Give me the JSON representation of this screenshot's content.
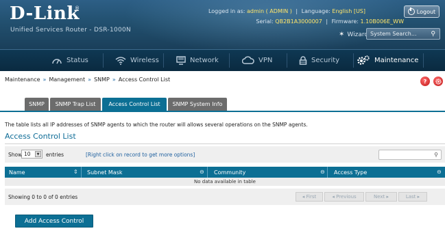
{
  "header": {
    "logo": "D-Link",
    "product": "Unified Services Router - DSR-1000N",
    "logged_in_label": "Logged in as:",
    "logged_in_value": "admin ( ADMIN )",
    "language_label": "Language:",
    "language_value": "English [US]",
    "serial_label": "Serial:",
    "serial_value": "QB2B1A3000007",
    "firmware_label": "Firmware:",
    "firmware_value": "1.10B006E_WW",
    "logout_label": "Logout",
    "wizard_label": "Wizard",
    "search_placeholder": "System Search..."
  },
  "nav": {
    "items": [
      {
        "label": "Status",
        "icon": "speedometer-icon"
      },
      {
        "label": "Wireless",
        "icon": "wifi-icon"
      },
      {
        "label": "Network",
        "icon": "monitor-icon"
      },
      {
        "label": "VPN",
        "icon": "cloud-icon"
      },
      {
        "label": "Security",
        "icon": "lock-icon"
      },
      {
        "label": "Maintenance",
        "icon": "gears-icon",
        "active": true
      }
    ]
  },
  "breadcrumb": {
    "items": [
      "Maintenance",
      "Management",
      "SNMP",
      "Access Control List"
    ],
    "separator": "»"
  },
  "tabs": [
    {
      "label": "SNMP"
    },
    {
      "label": "SNMP Trap List"
    },
    {
      "label": "Access Control List",
      "active": true
    },
    {
      "label": "SNMP System Info"
    }
  ],
  "content": {
    "description": "The table lists all IP addresses of SNMP agents to which the router will allows several operations on the SNMP agents.",
    "section_title": "Access Control List",
    "show_label": "Show",
    "entries_value": "10",
    "entries_label": "entries",
    "right_click_hint": "[Right click on record to get more options]",
    "columns": [
      "Name",
      "Subnet Mask",
      "Community",
      "Access Type"
    ],
    "empty_message": "No data available in table",
    "showing_text": "Showing 0 to 0 of 0 entries",
    "pager": {
      "first": "First",
      "previous": "Previous",
      "next": "Next",
      "last": "Last"
    },
    "add_button": "Add Access Control"
  },
  "colors": {
    "accent": "#0c6f94",
    "header_bg": "#22506f",
    "highlight_text": "#ffe56a",
    "tab_inactive": "#6c6c6c"
  }
}
